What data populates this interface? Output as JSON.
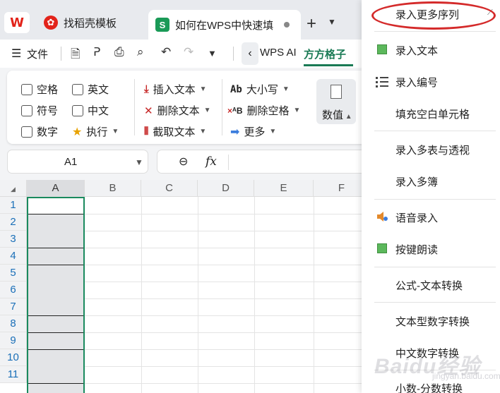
{
  "tabs": {
    "logo": "W",
    "items": [
      {
        "label": "找稻壳模板",
        "icon": "docer-icon"
      },
      {
        "label": "如何在WPS中快速填",
        "icon": "sheet-icon",
        "icon_text": "S"
      }
    ],
    "new_tab": "+",
    "more": "⌄"
  },
  "menubar": {
    "file": "文件",
    "wps_ai": "WPS AI",
    "active": "方方格子"
  },
  "ribbon": {
    "checkboxes": [
      {
        "label": "空格"
      },
      {
        "label": "英文"
      },
      {
        "label": "符号"
      },
      {
        "label": "中文"
      },
      {
        "label": "数字"
      }
    ],
    "execute": "执行",
    "insert_text": "插入文本",
    "delete_text": "删除文本",
    "extract_text": "截取文本",
    "case": "大小写",
    "case_icon": "Ab",
    "delete_space": "删除空格",
    "delete_space_icon": "ᴬB",
    "more": "更多",
    "numval": "数值"
  },
  "formula": {
    "cell_ref": "A1",
    "fx": "fx"
  },
  "grid": {
    "columns": [
      "A",
      "B",
      "C",
      "D",
      "E",
      "F"
    ],
    "rows": [
      "1",
      "2",
      "3",
      "4",
      "5",
      "6",
      "7",
      "8",
      "9",
      "10",
      "11"
    ],
    "accent": "#1a8a5e"
  },
  "dropdown": {
    "highlight_color": "#d42a2a",
    "items": [
      {
        "label": "录入更多序列"
      },
      {
        "label": "录入文本"
      },
      {
        "label": "录入编号"
      },
      {
        "label": "填充空白单元格"
      },
      {
        "label": "录入多表与透视"
      },
      {
        "label": "录入多簿"
      },
      {
        "label": "语音录入"
      },
      {
        "label": "按键朗读"
      },
      {
        "label": "公式-文本转换"
      },
      {
        "label": "文本型数字转换"
      },
      {
        "label": "中文数字转换"
      },
      {
        "label": "小数-分数转换"
      }
    ]
  },
  "watermark": {
    "brand": "Baidu经验",
    "sub": "jingyan.baidu.com"
  }
}
